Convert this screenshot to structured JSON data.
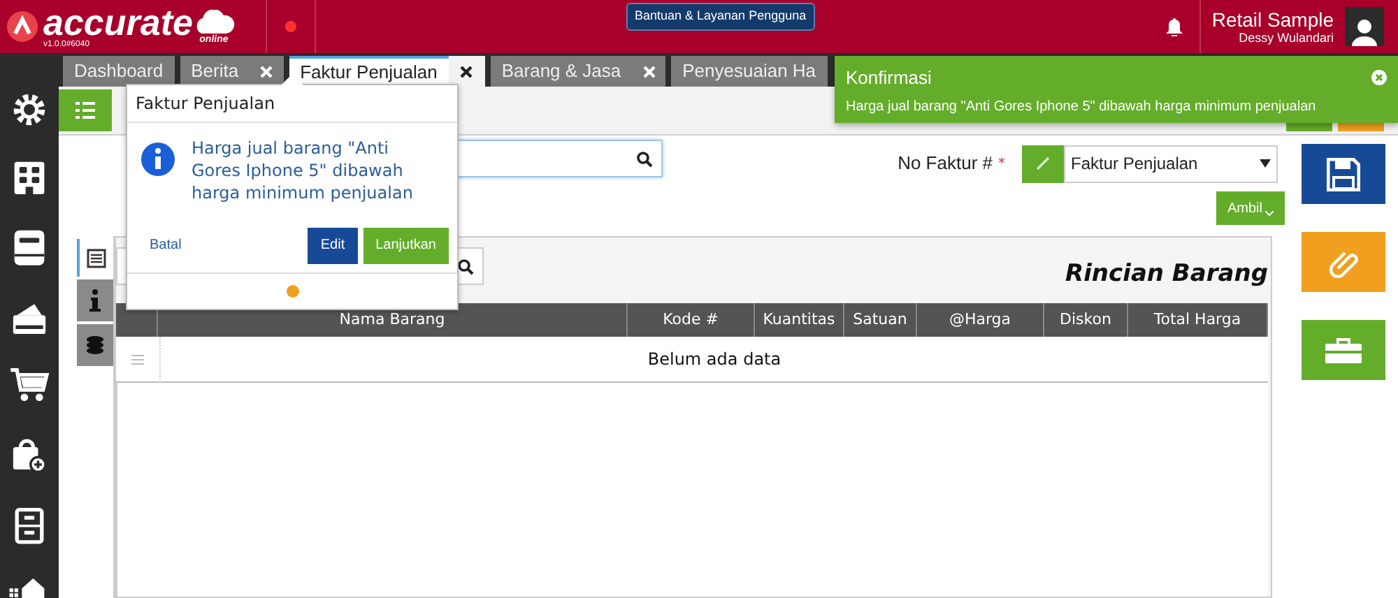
{
  "header": {
    "logo": "accurate",
    "logo_sub": "online",
    "version": "v1.0.0#6040",
    "help_button": "Bantuan & Layanan Pengguna",
    "company": "Retail Sample",
    "user": "Dessy Wulandari"
  },
  "tabs": [
    {
      "label": "Dashboard",
      "closable": false,
      "selected": false
    },
    {
      "label": "Berita",
      "closable": true,
      "selected": false
    },
    {
      "label": "Faktur Penjualan",
      "closable": true,
      "selected": true
    },
    {
      "label": "Barang & Jasa",
      "closable": true,
      "selected": false
    },
    {
      "label": "Penyesuaian Ha",
      "closable": false,
      "selected": false
    }
  ],
  "form": {
    "invoice_label": "No Faktur #",
    "required_mark": "*",
    "invoice_type": "Faktur Penjualan",
    "fetch_button": "Ambil"
  },
  "panel": {
    "title": "Rincian Barang",
    "side_tabs": [
      {
        "kind": "list",
        "selected": true
      },
      {
        "kind": "info",
        "selected": false
      },
      {
        "kind": "coins",
        "selected": false
      }
    ]
  },
  "table": {
    "columns": [
      "Nama Barang",
      "Kode #",
      "Kuantitas",
      "Satuan",
      "@Harga",
      "Diskon",
      "Total Harga"
    ],
    "empty_text": "Belum ada data"
  },
  "popup": {
    "title": "Faktur Penjualan",
    "message": "Harga jual barang \"Anti Gores Iphone 5\" dibawah harga minimum penjualan",
    "cancel_link": "Batal",
    "buttons": [
      {
        "label": "Edit",
        "kind": "primary"
      },
      {
        "label": "Lanjutkan",
        "kind": "success"
      }
    ]
  },
  "toast": {
    "title": "Konfirmasi",
    "message": "Harga jual barang \"Anti Gores Iphone 5\" dibawah harga minimum penjualan"
  }
}
